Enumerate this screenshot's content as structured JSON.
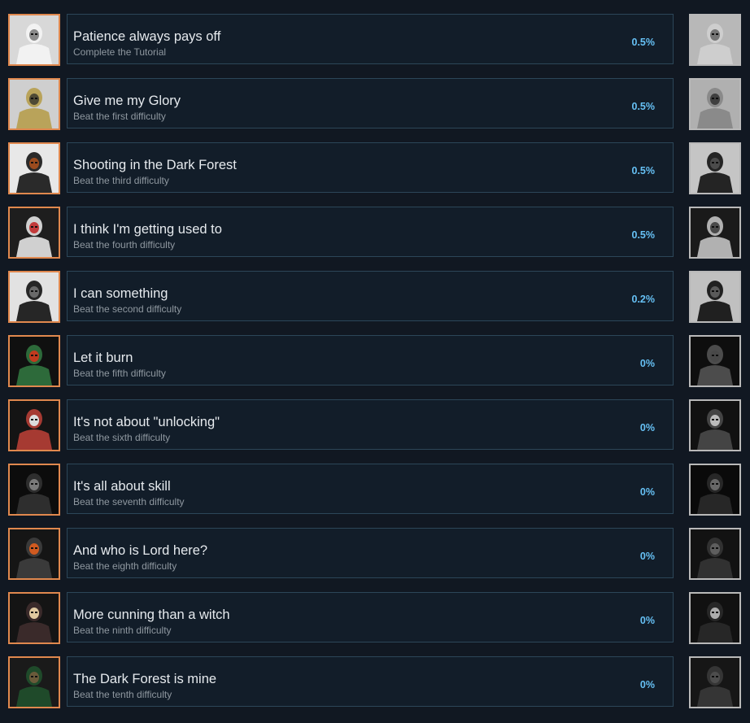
{
  "achievements": [
    {
      "title": "Patience always pays off",
      "desc": "Complete the Tutorial",
      "pct": "0.5%",
      "icon": "skeleton-knight-icon",
      "bg": "#d8d8d8",
      "fg": "#f2f2f2",
      "accent": "#8a8a8a"
    },
    {
      "title": "Give me my Glory",
      "desc": "Beat the first difficulty",
      "pct": "0.5%",
      "icon": "golden-knight-icon",
      "bg": "#cfcfcf",
      "fg": "#b9a35a",
      "accent": "#4f4a35"
    },
    {
      "title": "Shooting in the Dark Forest",
      "desc": "Beat the third difficulty",
      "pct": "0.5%",
      "icon": "hooded-archer-icon",
      "bg": "#e8e8e8",
      "fg": "#2a2a2a",
      "accent": "#9a4b1e"
    },
    {
      "title": "I think I'm getting used to",
      "desc": "Beat the fourth difficulty",
      "pct": "0.5%",
      "icon": "horned-skeleton-icon",
      "bg": "#1e1e1e",
      "fg": "#d0d0d0",
      "accent": "#c23a3a"
    },
    {
      "title": "I can something",
      "desc": "Beat the second difficulty",
      "pct": "0.2%",
      "icon": "dark-knight-sword-icon",
      "bg": "#e2e2e2",
      "fg": "#262626",
      "accent": "#6a6a6a"
    },
    {
      "title": "Let it burn",
      "desc": "Beat the fifth difficulty",
      "pct": "0%",
      "icon": "fire-wizard-icon",
      "bg": "#101010",
      "fg": "#2d6a3a",
      "accent": "#c23a1e"
    },
    {
      "title": "It's not about \"unlocking\"",
      "desc": "Beat the sixth difficulty",
      "pct": "0%",
      "icon": "vampire-lord-icon",
      "bg": "#141414",
      "fg": "#a63a32",
      "accent": "#dcdcdc"
    },
    {
      "title": "It's all about skill",
      "desc": "Beat the seventh difficulty",
      "pct": "0%",
      "icon": "shadow-demon-icon",
      "bg": "#0c0c0c",
      "fg": "#2e2e2e",
      "accent": "#7a7a7a"
    },
    {
      "title": "And who is Lord here?",
      "desc": "Beat the eighth difficulty",
      "pct": "0%",
      "icon": "crowned-lich-icon",
      "bg": "#151515",
      "fg": "#3a3a3a",
      "accent": "#d05a20"
    },
    {
      "title": "More cunning than a witch",
      "desc": "Beat the ninth difficulty",
      "pct": "0%",
      "icon": "witch-icon",
      "bg": "#141414",
      "fg": "#3a2a2a",
      "accent": "#e0c8a0"
    },
    {
      "title": "The Dark Forest is mine",
      "desc": "Beat the tenth difficulty",
      "pct": "0%",
      "icon": "dark-forest-icon",
      "bg": "#1a1a1a",
      "fg": "#1f4a2a",
      "accent": "#6a5a3a"
    }
  ]
}
